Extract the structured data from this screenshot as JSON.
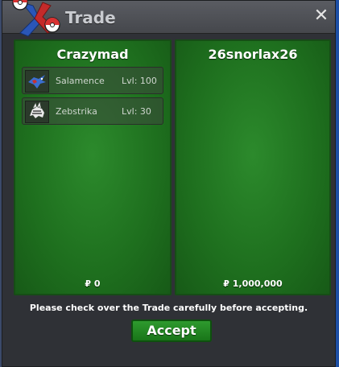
{
  "window": {
    "title": "Trade",
    "close_symbol": "✕"
  },
  "left_panel": {
    "player_name": "Crazymad",
    "pokemon": [
      {
        "name": "Salamence",
        "level": "Lvl: 100",
        "icon": "salamence-sprite-icon"
      },
      {
        "name": "Zebstrika",
        "level": "Lvl: 30",
        "icon": "zebstrika-sprite-icon"
      }
    ],
    "money": "₽ 0"
  },
  "right_panel": {
    "player_name": "26snorlax26",
    "pokemon": [],
    "money": "₽ 1,000,000"
  },
  "footer": {
    "notice": "Please check over the Trade carefully before accepting.",
    "accept_label": "Accept"
  },
  "colors": {
    "panel_green": "#1e6f1e",
    "accept_green": "#2e9a2e",
    "window_bg": "#2f3136"
  }
}
